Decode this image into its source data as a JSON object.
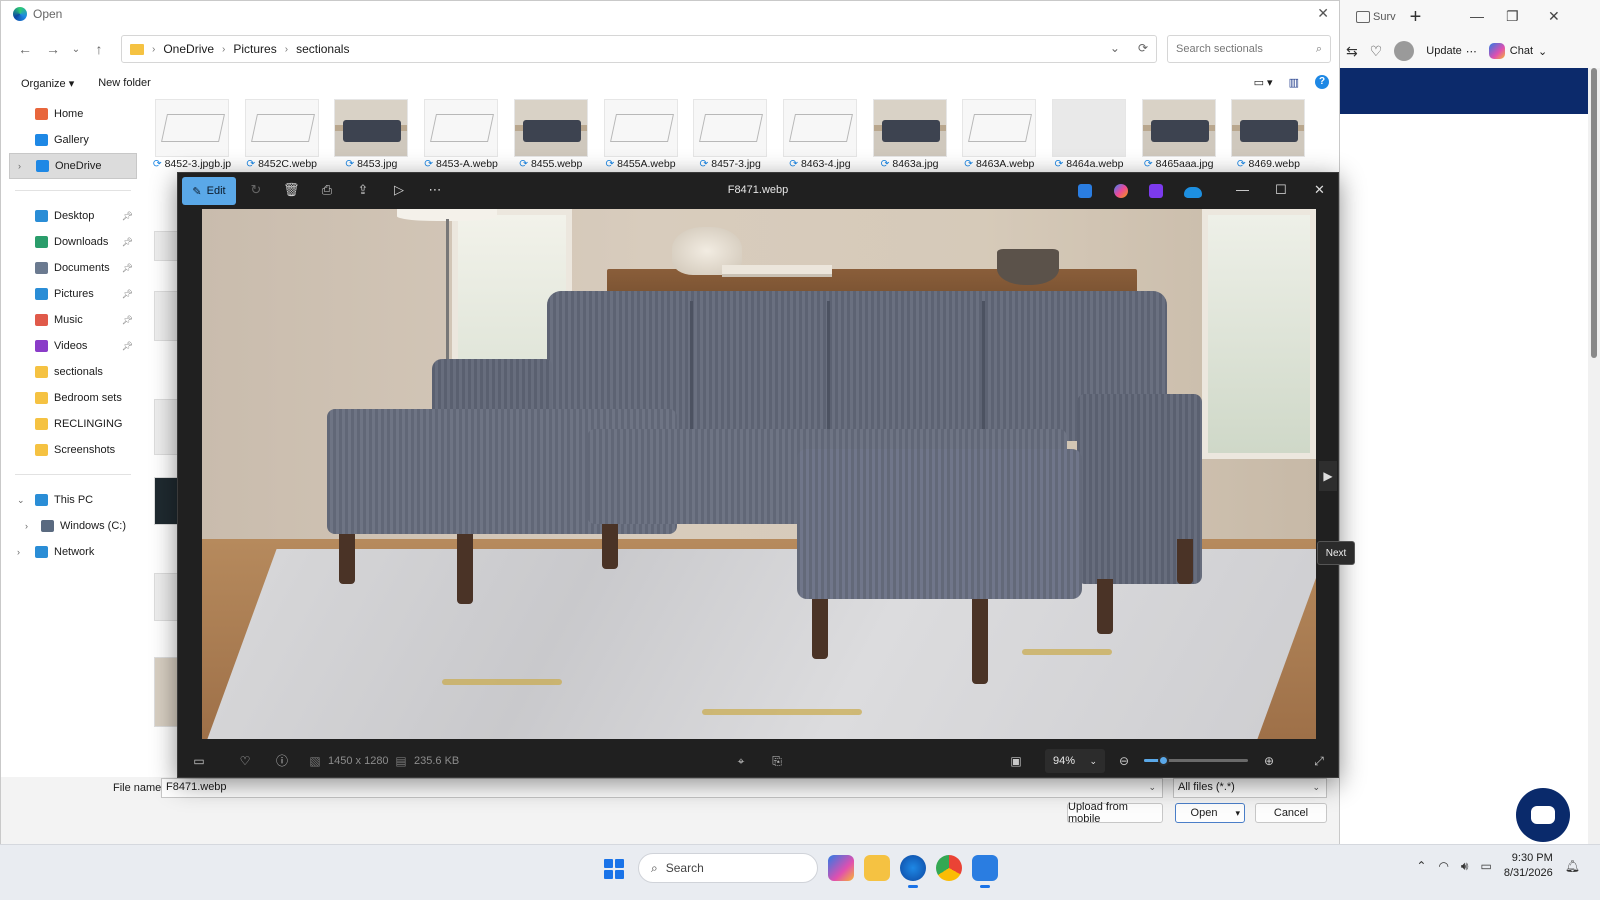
{
  "browser": {
    "tab_label": "Surv",
    "update_label": "Update",
    "chat_label": "Chat"
  },
  "dialog": {
    "title": "Open",
    "breadcrumb": [
      "OneDrive",
      "Pictures",
      "sectionals"
    ],
    "search_placeholder": "Search sectionals",
    "organize_label": "Organize",
    "new_folder_label": "New folder",
    "nav_items": [
      {
        "label": "Home",
        "icon": "home-icon",
        "color": "#e8663c"
      },
      {
        "label": "Gallery",
        "icon": "gallery-icon",
        "color": "#1e88e5"
      },
      {
        "label": "OneDrive",
        "icon": "cloud-icon",
        "color": "#1e88e5"
      },
      {
        "label": "Desktop",
        "icon": "desktop-icon",
        "color": "#2a8dd6"
      },
      {
        "label": "Downloads",
        "icon": "download-icon",
        "color": "#2a9d6b"
      },
      {
        "label": "Documents",
        "icon": "document-icon",
        "color": "#6b7a90"
      },
      {
        "label": "Pictures",
        "icon": "pictures-icon",
        "color": "#2a8dd6"
      },
      {
        "label": "Music",
        "icon": "music-icon",
        "color": "#e05a4a"
      },
      {
        "label": "Videos",
        "icon": "videos-icon",
        "color": "#8a3cc8"
      },
      {
        "label": "sectionals",
        "icon": "folder-icon",
        "color": "#f5c242"
      },
      {
        "label": "Bedroom sets",
        "icon": "folder-icon",
        "color": "#f5c242"
      },
      {
        "label": "RECLINGING",
        "icon": "folder-icon",
        "color": "#f5c242"
      },
      {
        "label": "Screenshots",
        "icon": "folder-icon",
        "color": "#f5c242"
      },
      {
        "label": "This PC",
        "icon": "pc-icon",
        "color": "#2a8dd6"
      },
      {
        "label": "Windows (C:)",
        "icon": "drive-icon",
        "color": "#5a6a80"
      },
      {
        "label": "Network",
        "icon": "network-icon",
        "color": "#2a8dd6"
      }
    ],
    "files": [
      {
        "name": "8452-3.jpgb.jp",
        "kind": "line"
      },
      {
        "name": "8452C.webp",
        "kind": "line"
      },
      {
        "name": "8453.jpg",
        "kind": "photo"
      },
      {
        "name": "8453-A.webp",
        "kind": "line"
      },
      {
        "name": "8455.webp",
        "kind": "photo"
      },
      {
        "name": "8455A.webp",
        "kind": "line"
      },
      {
        "name": "8457-3.jpg",
        "kind": "line"
      },
      {
        "name": "8463-4.jpg",
        "kind": "line"
      },
      {
        "name": "8463a.jpg",
        "kind": "photo"
      },
      {
        "name": "8463A.webp",
        "kind": "line"
      },
      {
        "name": "8464a.webp",
        "kind": "light"
      },
      {
        "name": "8465aaa.jpg",
        "kind": "photo"
      },
      {
        "name": "8469.webp",
        "kind": "photo"
      }
    ],
    "file_name_label": "File name:",
    "file_name_value": "F8471.webp",
    "file_type_value": "All files (*.*)",
    "upload_label": "Upload from mobile",
    "open_label": "Open",
    "cancel_label": "Cancel"
  },
  "viewer": {
    "edit_label": "Edit",
    "title": "F8471.webp",
    "dimensions": "1450 x 1280",
    "file_size": "235.6 KB",
    "zoom_value": "94%",
    "zoom_fraction": 0.18,
    "next_tooltip": "Next"
  },
  "taskbar": {
    "search_label": "Search",
    "time": "9:30 PM",
    "date": "8/31/2026"
  }
}
